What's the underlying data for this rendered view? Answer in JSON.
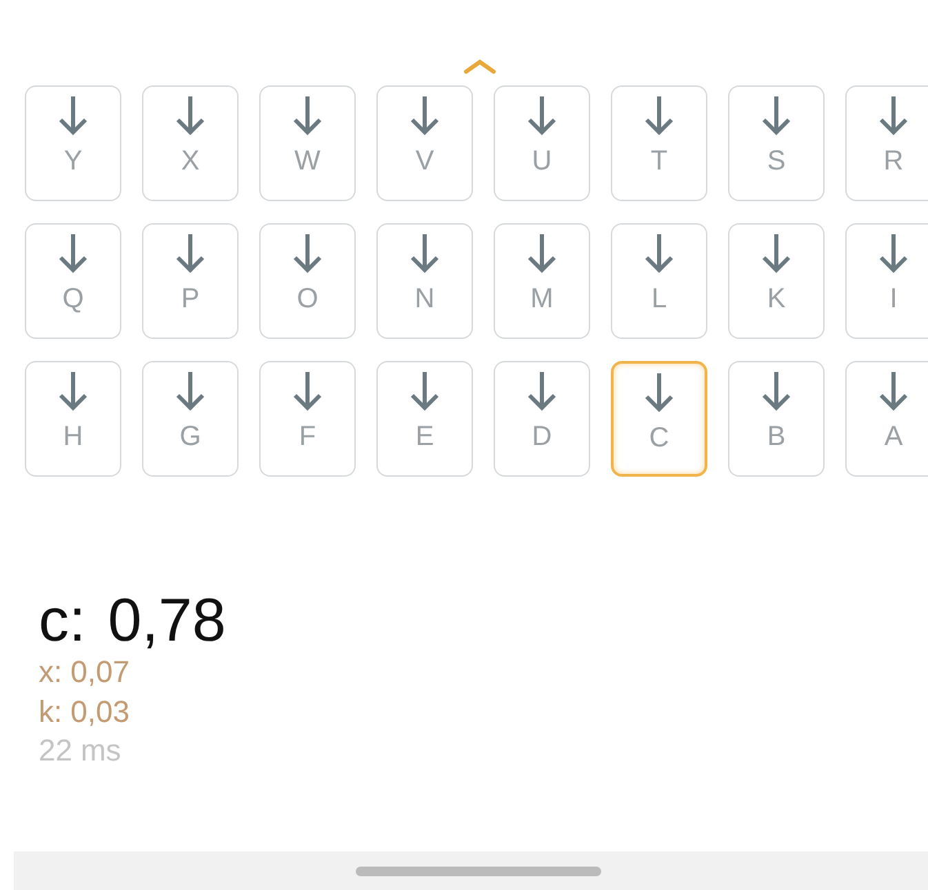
{
  "key_rows": [
    {
      "keys": [
        {
          "letter": "Y",
          "selected": false
        },
        {
          "letter": "X",
          "selected": false
        },
        {
          "letter": "W",
          "selected": false
        },
        {
          "letter": "V",
          "selected": false
        },
        {
          "letter": "U",
          "selected": false
        },
        {
          "letter": "T",
          "selected": false
        },
        {
          "letter": "S",
          "selected": false
        },
        {
          "letter": "R",
          "selected": false
        }
      ]
    },
    {
      "keys": [
        {
          "letter": "Q",
          "selected": false
        },
        {
          "letter": "P",
          "selected": false
        },
        {
          "letter": "O",
          "selected": false
        },
        {
          "letter": "N",
          "selected": false
        },
        {
          "letter": "M",
          "selected": false
        },
        {
          "letter": "L",
          "selected": false
        },
        {
          "letter": "K",
          "selected": false
        },
        {
          "letter": "I",
          "selected": false
        }
      ]
    },
    {
      "keys": [
        {
          "letter": "H",
          "selected": false
        },
        {
          "letter": "G",
          "selected": false
        },
        {
          "letter": "F",
          "selected": false
        },
        {
          "letter": "E",
          "selected": false
        },
        {
          "letter": "D",
          "selected": false
        },
        {
          "letter": "C",
          "selected": true
        },
        {
          "letter": "B",
          "selected": false
        },
        {
          "letter": "A",
          "selected": false
        }
      ]
    }
  ],
  "result": {
    "label": "c:",
    "value": "0,78"
  },
  "scores": [
    {
      "label": "x:",
      "value": "0,07",
      "kind": "score"
    },
    {
      "label": "k:",
      "value": "0,03",
      "kind": "score"
    },
    {
      "label": "22",
      "value": "ms",
      "kind": "timing"
    }
  ]
}
